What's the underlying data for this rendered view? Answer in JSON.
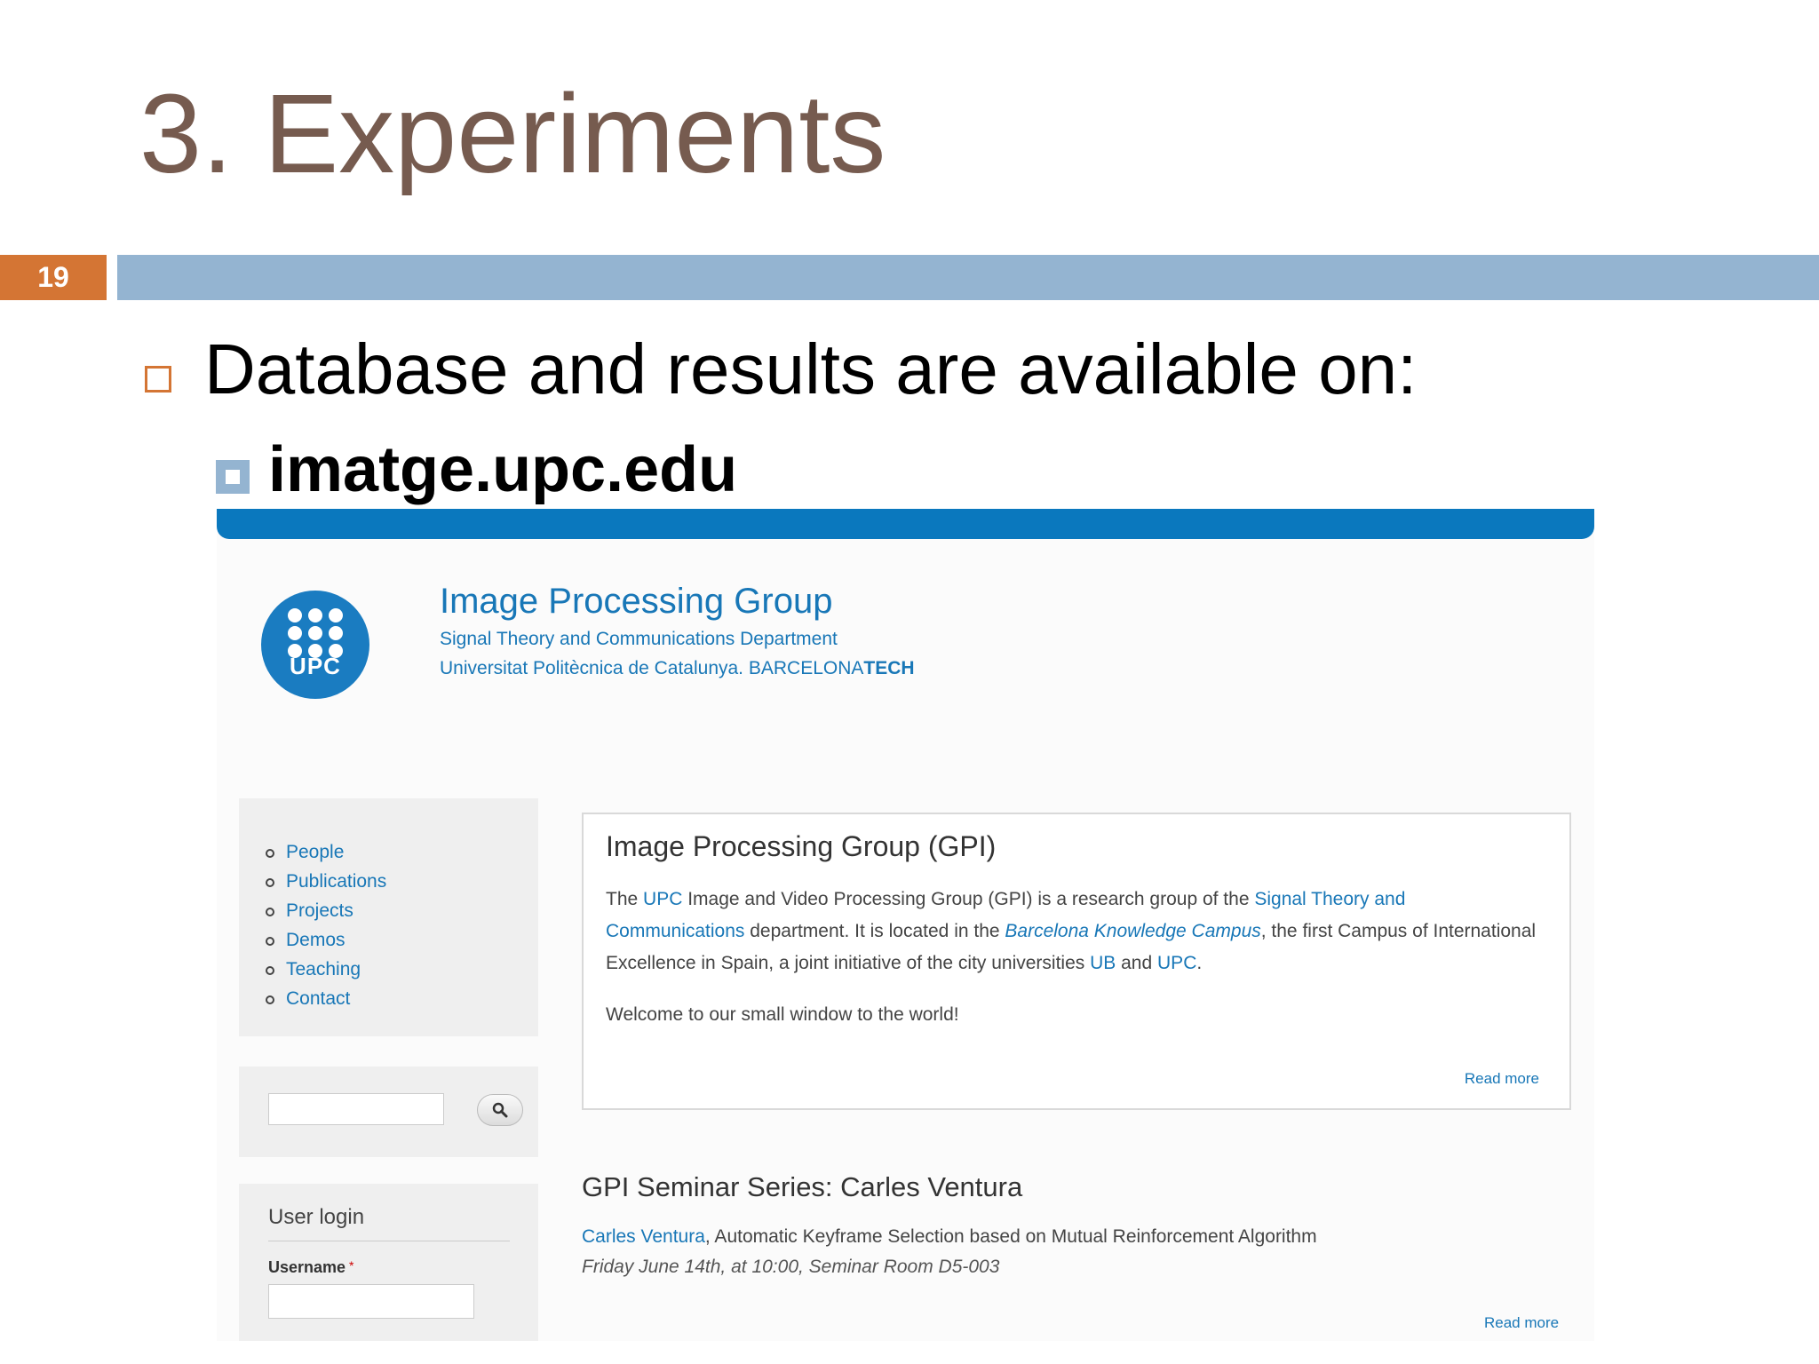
{
  "slide": {
    "title": "3. Experiments",
    "number": "19",
    "bullet_main": "Database and results are available on:",
    "bullet_sub": "imatge.upc.edu"
  },
  "colors": {
    "title": "#765b4f",
    "accent_orange": "#d47534",
    "band_blue": "#94b4d1",
    "site_blue": "#1877b7"
  },
  "website": {
    "logo_text": "UPC",
    "title": "Image Processing Group",
    "subtitle_line1": "Signal Theory and Communications Department",
    "subtitle_line2_prefix": "Universitat Politècnica de Catalunya. BARCELONA",
    "subtitle_line2_bold": "TECH",
    "menu": [
      "People",
      "Publications",
      "Projects",
      "Demos",
      "Teaching",
      "Contact"
    ],
    "search": {
      "placeholder": "",
      "icon": "search-icon"
    },
    "login": {
      "title": "User login",
      "username_label": "Username",
      "required_mark": "*"
    },
    "gpi": {
      "title": "Image Processing Group (GPI)",
      "text_the": "The ",
      "link_upc": "UPC",
      "text_1": " Image and Video Processing Group (GPI) is a research group of the ",
      "link_dept": "Signal Theory and Communications",
      "text_2": " department. It is located in the ",
      "link_campus": "Barcelona Knowledge Campus",
      "text_3": ", the first Campus of International Excellence in Spain, a joint initiative of the city universities ",
      "link_ub": "UB",
      "text_and": " and ",
      "link_upc2": "UPC",
      "text_end": ".",
      "welcome": "Welcome to our small window to the world!",
      "read_more": "Read more"
    },
    "seminar": {
      "title": "GPI Seminar Series: Carles Ventura",
      "speaker": "Carles Ventura",
      "talk": ", Automatic Keyframe Selection based on Mutual Reinforcement Algorithm",
      "when": "Friday June 14th, at 10:00, Seminar Room D5-003",
      "read_more": "Read more"
    }
  }
}
